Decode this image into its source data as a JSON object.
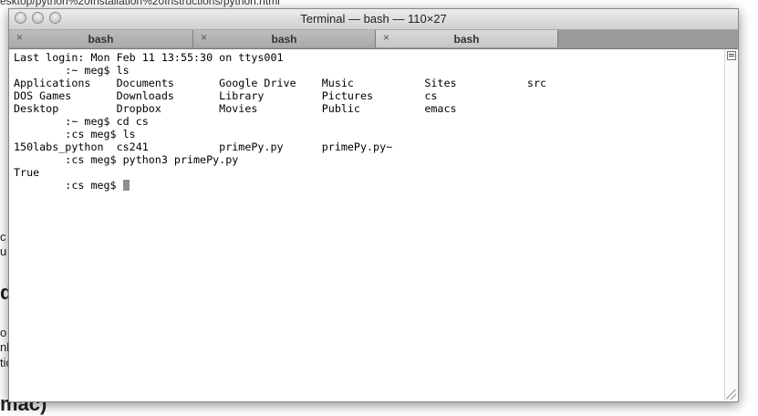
{
  "background": {
    "url_fragment": "esktop/python%20Installation%20Instructions/python.html",
    "fragments": [
      "c",
      "u",
      "d",
      "o",
      "nl",
      "tic",
      "mac)"
    ]
  },
  "window": {
    "title": "Terminal — bash — 110×27",
    "controls": [
      "close",
      "minimize",
      "zoom"
    ]
  },
  "tabs": [
    {
      "label": "bash",
      "close_icon": "×"
    },
    {
      "label": "bash",
      "close_icon": "×"
    },
    {
      "label": "bash",
      "close_icon": "×"
    }
  ],
  "terminal": {
    "lines": [
      "Last login: Mon Feb 11 13:55:30 on ttys001",
      "        :~ meg$ ls",
      "Applications    Documents       Google Drive    Music           Sites           src",
      "DOS Games       Downloads       Library         Pictures        cs",
      "Desktop         Dropbox         Movies          Public          emacs",
      "        :~ meg$ cd cs",
      "        :cs meg$ ls",
      "150labs_python  cs241           primePy.py      primePy.py~",
      "        :cs meg$ python3 primePy.py",
      "True"
    ],
    "prompt": "        :cs meg$ "
  }
}
